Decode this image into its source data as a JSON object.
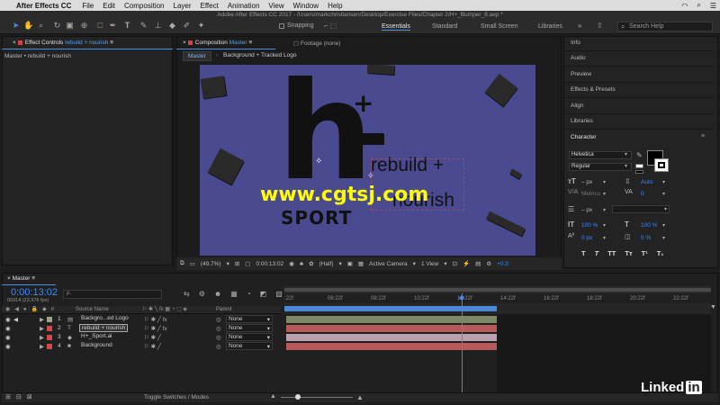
{
  "menubar": {
    "app_name": "After Effects CC",
    "items": [
      "File",
      "Edit",
      "Composition",
      "Layer",
      "Effect",
      "Animation",
      "View",
      "Window",
      "Help"
    ]
  },
  "window_title": "Adobe After Effects CC 2017 - /Users/markchristiansen/Desktop/Exercise Files/Chapter 2/H+_Bumper_8.aep *",
  "toolbar": {
    "snapping_label": "Snapping",
    "workspaces": [
      "Essentials",
      "Standard",
      "Small Screen",
      "Libraries"
    ],
    "active_workspace": "Essentials",
    "search_placeholder": "Search Help"
  },
  "effect_controls": {
    "tab_label": "Effect Controls",
    "tab_layer": "rebuild + nourish",
    "path": "Master • rebuild + nourish"
  },
  "composition_panel": {
    "tab_label": "Composition",
    "tab_name": "Master",
    "footage_tab": "Footage (none)",
    "breadcrumb_active": "Master",
    "breadcrumb_next": "Background + Tracked Logo"
  },
  "canvas": {
    "logo_letter": "h",
    "logo_plus": "+",
    "word": "SPORT",
    "text1": "rebuild +",
    "text2": "nourish",
    "watermark": "www.cgtsj.com",
    "bg_color": "#4a4a90"
  },
  "viewer_bar": {
    "zoom": "(49.7%)",
    "timecode": "0:00:13:02",
    "resolution": "(Half)",
    "camera": "Active Camera",
    "views": "1 View",
    "offset": "+0.0"
  },
  "right_panel": {
    "items": [
      "Info",
      "Audio",
      "Preview",
      "Effects & Presets",
      "Align",
      "Libraries"
    ],
    "character_title": "Character",
    "font_family": "Helvetica",
    "font_style": "Regular",
    "size": "– px",
    "leading": "Auto",
    "kerning": "Metrics",
    "tracking": "0",
    "stroke": "– px",
    "vscale": "100 %",
    "hscale": "100 %",
    "baseline": "0 px",
    "tsume": "0 %",
    "buttons": [
      "T",
      "T",
      "TT",
      "Tт",
      "T¹",
      "T₁"
    ]
  },
  "timeline": {
    "tab": "Master",
    "timecode": "0:00:13:02",
    "frames": "00314 (23.976 fps)",
    "search_placeholder": "ρ.",
    "col_source": "Source Name",
    "col_parent": "Parent",
    "ticks": [
      ":22f",
      "06:22f",
      "08:22f",
      "10:22f",
      "12:22f",
      "14:22f",
      "16:22f",
      "18:22f",
      "20:22f",
      "22:22f"
    ],
    "layers": [
      {
        "num": "1",
        "name": "Backgro...ed Logo",
        "type": "comp",
        "color": "#9aa58a",
        "parent": "None"
      },
      {
        "num": "2",
        "name": "rebuild + nourish",
        "type": "text",
        "color": "#d14a4a",
        "parent": "None"
      },
      {
        "num": "3",
        "name": "H+_Sport.ai",
        "type": "ai",
        "color": "#d14a4a",
        "parent": "None"
      },
      {
        "num": "4",
        "name": "Background",
        "type": "solid",
        "color": "#d14a4a",
        "parent": "None"
      }
    ],
    "toggle_label": "Toggle Switches / Modes"
  },
  "branding": {
    "linkedin": "Linked",
    "linkedin_in": "in"
  }
}
